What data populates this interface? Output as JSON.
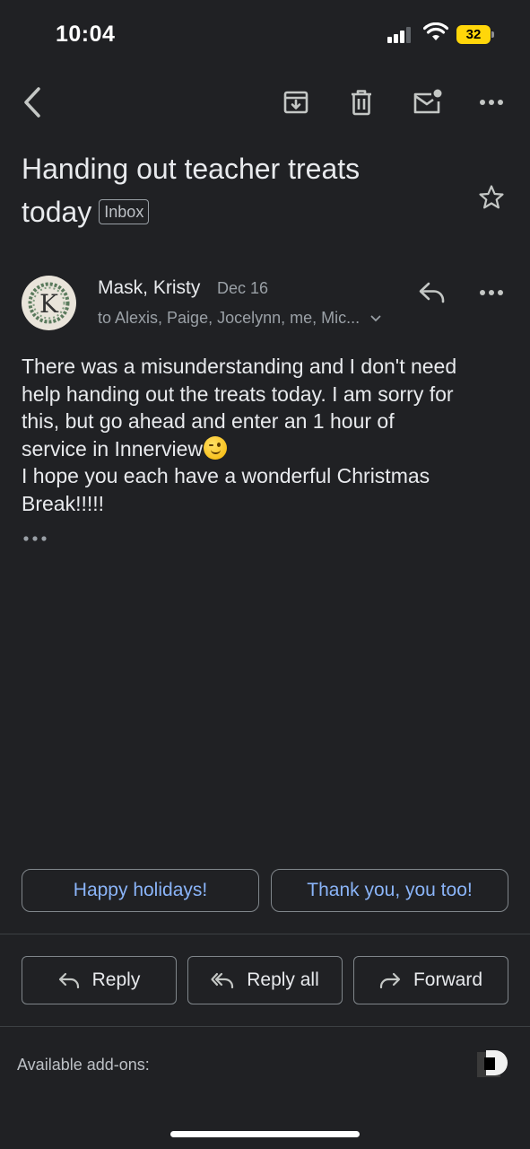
{
  "status_bar": {
    "time": "10:04",
    "battery": "32"
  },
  "toolbar": {
    "icons": [
      "back-icon",
      "archive-icon",
      "trash-icon",
      "mark-unread-icon",
      "more-icon"
    ]
  },
  "email": {
    "subject_line1": "Handing out teacher treats",
    "subject_line2": "today",
    "label": "Inbox",
    "sender_name": "Mask, Kristy",
    "date": "Dec 16",
    "recipients": "to Alexis, Paige, Jocelynn, me, Mic...",
    "avatar_letter": "K",
    "body_lines": [
      "There was a misunderstanding and I don't need",
      "help handing out the treats today. I am sorry for",
      "this, but go ahead and enter an 1 hour of",
      "service in Innerview",
      "I hope you each have a wonderful Christmas",
      "Break!!!!!"
    ]
  },
  "smart_replies": [
    "Happy holidays!",
    "Thank you, you too!"
  ],
  "actions": {
    "reply": "Reply",
    "reply_all": "Reply all",
    "forward": "Forward"
  },
  "addons_label": "Available add-ons:",
  "colors": {
    "background": "#202124",
    "link": "#8ab4f8",
    "battery": "#ffd60a"
  }
}
